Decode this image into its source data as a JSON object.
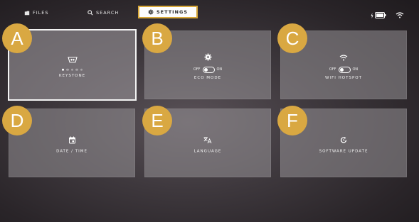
{
  "nav": {
    "files": {
      "label": "FILES",
      "icon": "folder-icon"
    },
    "search": {
      "label": "SEARCH",
      "icon": "search-icon"
    },
    "settings": {
      "label": "SETTINGS",
      "icon": "gear-icon",
      "active": true
    }
  },
  "status": {
    "battery_icon": "battery-icon",
    "wifi_icon": "wifi-icon"
  },
  "tiles": {
    "keystone": {
      "label": "KEYSTONE",
      "icon": "keystone-icon",
      "page_dots": 5,
      "active_dot": 1
    },
    "eco_mode": {
      "label": "ECO MODE",
      "icon": "gear-icon",
      "off_label": "OFF",
      "on_label": "ON",
      "state": "off"
    },
    "wifi_hotspot": {
      "label": "WIFI HOTSPOT",
      "icon": "wifi-icon",
      "off_label": "OFF",
      "on_label": "ON",
      "state": "off"
    },
    "date_time": {
      "label": "DATE / TIME",
      "icon": "calendar-icon"
    },
    "language": {
      "label": "LANGUAGE",
      "icon": "translate-icon"
    },
    "software_update": {
      "label": "SOFTWARE UPDATE",
      "icon": "update-icon"
    }
  },
  "badges": {
    "a": "A",
    "b": "B",
    "c": "C",
    "d": "D",
    "e": "E",
    "f": "F"
  },
  "colors": {
    "accent": "#d9a842",
    "settings_tab_border": "#d9a93a"
  }
}
